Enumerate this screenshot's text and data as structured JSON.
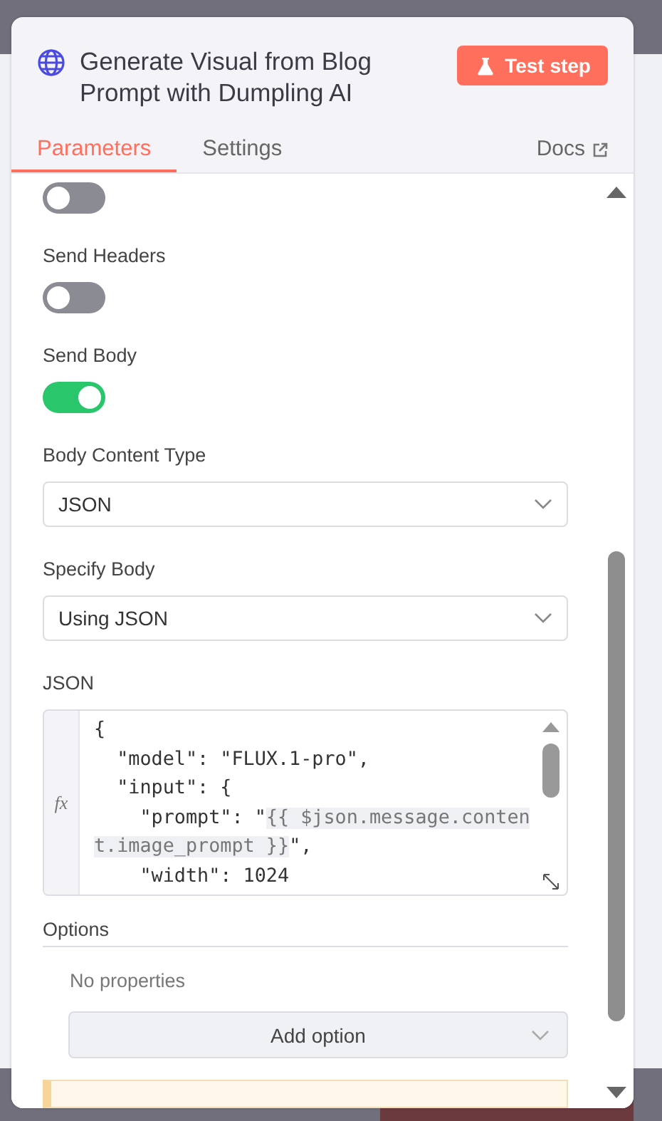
{
  "node": {
    "title": "Generate Visual from Blog Prompt with Dumpling AI",
    "test_button": "Test step"
  },
  "tabs": [
    {
      "label": "Parameters",
      "selected": true
    },
    {
      "label": "Settings",
      "selected": false
    }
  ],
  "docs_link": "Docs",
  "fields": [
    {
      "kind": "toggle",
      "on": false
    },
    {
      "kind": "toggle",
      "label": "Send Headers",
      "on": false
    },
    {
      "kind": "toggle",
      "label": "Send Body",
      "on": true
    },
    {
      "kind": "select",
      "label": "Body Content Type",
      "value": "JSON"
    },
    {
      "kind": "select",
      "label": "Specify Body",
      "value": "Using JSON"
    },
    {
      "kind": "code",
      "label": "JSON",
      "gutter_label": "fx",
      "lines": [
        [
          {
            "text": "{",
            "expression": false
          }
        ],
        [
          {
            "text": "  \"model\": \"FLUX.1-pro\",",
            "expression": false
          }
        ],
        [
          {
            "text": "  \"input\": {",
            "expression": false
          }
        ],
        [
          {
            "text": "    \"prompt\": \"",
            "expression": false
          },
          {
            "text": "{{ $json.message.content.image_prompt }}",
            "expression": true
          },
          {
            "text": "\",",
            "expression": false
          }
        ],
        [
          {
            "text": "    \"width\": 1024",
            "expression": false
          }
        ]
      ]
    }
  ],
  "options": {
    "label": "Options",
    "empty_text": "No properties",
    "add_button": "Add option"
  }
}
